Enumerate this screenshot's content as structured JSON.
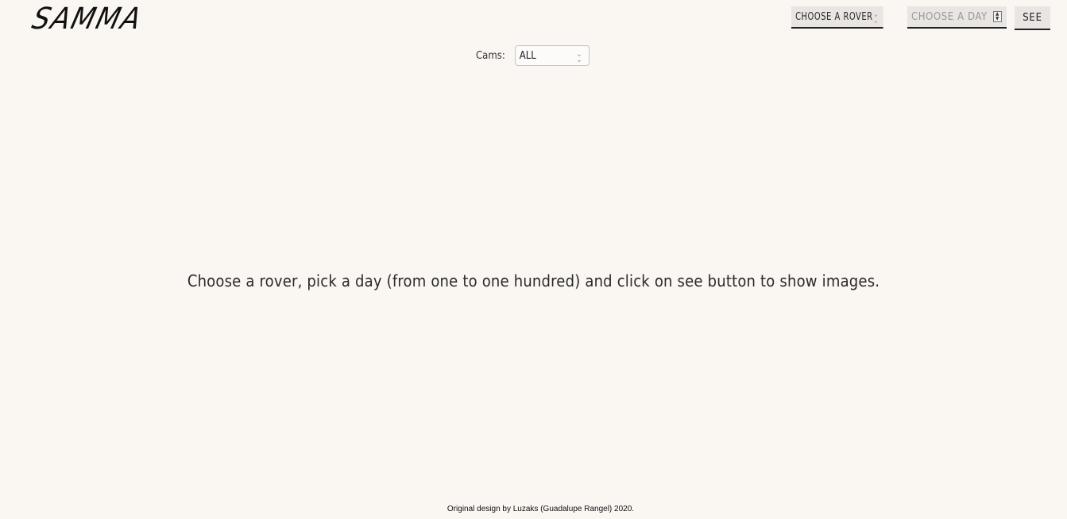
{
  "header": {
    "logo": "SAMMA",
    "rover_select": {
      "value": "CHOOSE A ROVER"
    },
    "day_input": {
      "placeholder": "CHOOSE A DAY"
    },
    "see_button": "SEE"
  },
  "filters": {
    "cams_label": "Cams:",
    "cams_value": "ALL"
  },
  "main": {
    "message": "Choose a rover, pick a day (from one to one hundred) and click on see button to show images."
  },
  "footer": {
    "credit": "Original design by Luzaks (Guadalupe Rangel) 2020."
  },
  "colors": {
    "background": "#faf6f2",
    "control_bg": "#e8e5e3",
    "text": "#2a2a2a"
  }
}
